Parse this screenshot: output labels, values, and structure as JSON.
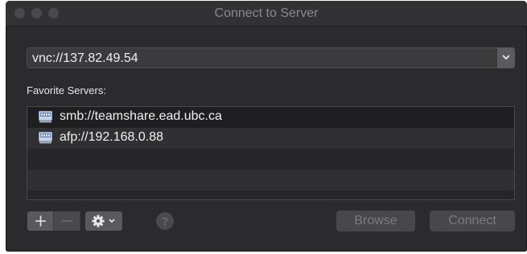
{
  "window": {
    "title": "Connect to Server"
  },
  "server": {
    "address": "vnc://137.82.49.54"
  },
  "favorites": {
    "label": "Favorite Servers:",
    "items": [
      {
        "label": "smb://teamshare.ead.ubc.ca",
        "icon": "server-icon"
      },
      {
        "label": "afp://192.168.0.88",
        "icon": "server-icon"
      }
    ]
  },
  "toolbar": {
    "add_label": "+",
    "remove_label": "—",
    "help_label": "?",
    "browse_label": "Browse",
    "connect_label": "Connect"
  },
  "colors": {
    "window_bg": "#2b2b2d",
    "titlebar_bg": "#323234",
    "text_primary": "#f0f0f0",
    "text_disabled": "#7b7b7e"
  }
}
